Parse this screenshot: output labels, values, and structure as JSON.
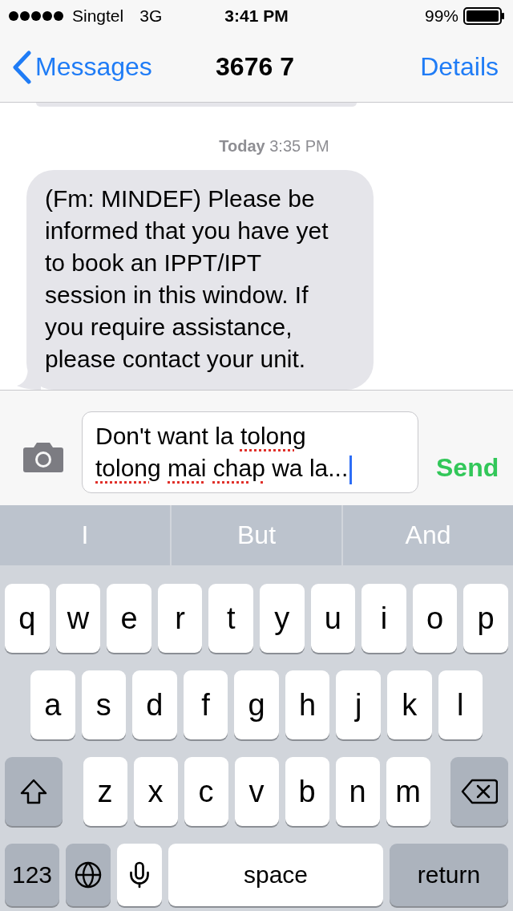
{
  "status_bar": {
    "carrier": "Singtel",
    "network": "3G",
    "time": "3:41 PM",
    "battery": "99%"
  },
  "nav_bar": {
    "back": "Messages",
    "title": "3676 7",
    "details": "Details"
  },
  "conversation": {
    "timestamp": "**Today** 3:35 PM",
    "messages": [
      {
        "kind": "partial"
      },
      {
        "kind": "incoming",
        "text": "(Fm: MINDEF) Please be informed that you have yet to book an IPPT/IPT session in this window. If you require assistance, please contact your unit."
      }
    ]
  },
  "composer": {
    "words": [
      {
        "text": "Don't",
        "misspelled": false
      },
      {
        "text": "want",
        "misspelled": false
      },
      {
        "text": "la",
        "misspelled": false
      },
      {
        "text": "tolong",
        "misspelled": true
      },
      {
        "text": "tolong",
        "misspelled": true
      },
      {
        "text": "mai",
        "misspelled": true
      },
      {
        "text": "chap",
        "misspelled": true
      },
      {
        "text": "wa",
        "misspelled": false
      },
      {
        "text": "la...",
        "misspelled": false
      }
    ],
    "send": "Send"
  },
  "keyboard": {
    "suggestions": [
      "I",
      "But",
      "And"
    ],
    "rows": [
      [
        "q",
        "w",
        "e",
        "r",
        "t",
        "y",
        "u",
        "i",
        "o",
        "p"
      ],
      [
        "a",
        "s",
        "d",
        "f",
        "g",
        "h",
        "j",
        "k",
        "l"
      ],
      [
        "z",
        "x",
        "c",
        "v",
        "b",
        "n",
        "m"
      ]
    ],
    "numbers_key": "123",
    "space_key": "space",
    "return_key": "return"
  }
}
